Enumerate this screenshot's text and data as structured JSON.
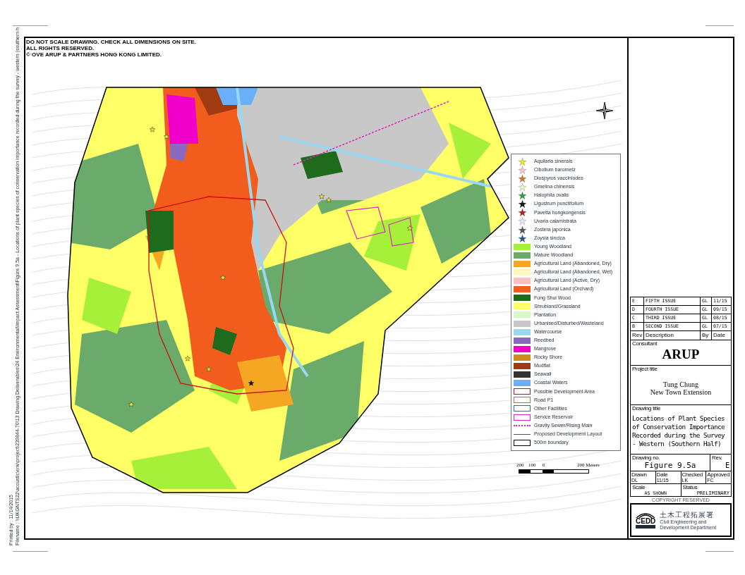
{
  "print_info": {
    "printed": "Printed by : 11/14/2015",
    "filename": "Filename : \\\\UKGNTS22\\acoustic\\env\\project\\239844-70\\13 Drawing Deliverables\\24 Environmental\\Impact Assessment\\Figure 9.5a - Locations of plant species of conservation importance recorded during the survey - western (southern h"
  },
  "notes": [
    "DO NOT SCALE DRAWING. CHECK ALL DIMENSIONS ON SITE.",
    "ALL RIGHTS RESERVED.",
    "© OVE ARUP & PARTNERS HONG KONG LIMITED."
  ],
  "legend": [
    {
      "kind": "star",
      "label": "Aquilaria sinensis",
      "color": "#e6e62e"
    },
    {
      "kind": "star",
      "label": "Cibotium barometz",
      "color": "#f2c4d4"
    },
    {
      "kind": "star",
      "label": "Diospyros vacciniodes",
      "color": "#c87832"
    },
    {
      "kind": "star",
      "label": "Gmelina chinensis",
      "color": "#eef0c8"
    },
    {
      "kind": "star",
      "label": "Halophila ovalis",
      "color": "#2e9e3e"
    },
    {
      "kind": "star",
      "label": "Ligustrum punctifolium",
      "color": "#111111"
    },
    {
      "kind": "star",
      "label": "Pavetta hongkongensis",
      "color": "#b02020"
    },
    {
      "kind": "star",
      "label": "Uvaria calamistrata",
      "color": "#e0e8f8"
    },
    {
      "kind": "star",
      "label": "Zostera japonica",
      "color": "#555555"
    },
    {
      "kind": "star",
      "label": "Zoysia sincica",
      "color": "#2a5a8a"
    },
    {
      "kind": "fill",
      "label": "Young Woodland",
      "color": "#a6f03a"
    },
    {
      "kind": "fill",
      "label": "Mature Woodland",
      "color": "#6aaa6a"
    },
    {
      "kind": "fill",
      "label": "Agricultural Land (Abandoned, Dry)",
      "color": "#f5a623"
    },
    {
      "kind": "fill",
      "label": "Agricultural Land (Abandoned, Wet)",
      "color": "#fff6c0"
    },
    {
      "kind": "fill",
      "label": "Agricultural Land (Active, Dry)",
      "color": "#f8c0c0"
    },
    {
      "kind": "fill",
      "label": "Agricultural Land (Orchard)",
      "color": "#f25c1c"
    },
    {
      "kind": "fill",
      "label": "Fung Shui Wood",
      "color": "#1e6b1e"
    },
    {
      "kind": "fill",
      "label": "Shrubland/Grassland",
      "color": "#ffff66"
    },
    {
      "kind": "fill",
      "label": "Plantation",
      "color": "#d8f8c8"
    },
    {
      "kind": "fill",
      "label": "Urbanised/Disturbed/Wasteland",
      "color": "#c8c8c8"
    },
    {
      "kind": "fill",
      "label": "Watercourse",
      "color": "#9ad8f2"
    },
    {
      "kind": "fill",
      "label": "Reedbed",
      "color": "#8a6ac0"
    },
    {
      "kind": "fill",
      "label": "Mangrove",
      "color": "#f000c8"
    },
    {
      "kind": "fill",
      "label": "Rocky Shore",
      "color": "#d08a20"
    },
    {
      "kind": "fill",
      "label": "Mudflat",
      "color": "#a03a10"
    },
    {
      "kind": "fill",
      "label": "Seawall",
      "color": "#333333"
    },
    {
      "kind": "fill",
      "label": "Coastal Waters",
      "color": "#6ab0f8"
    },
    {
      "kind": "outline",
      "label": "Possible Development Area",
      "color": "#d01010"
    },
    {
      "kind": "outline",
      "label": "Road P1",
      "color": "#b07820"
    },
    {
      "kind": "outline",
      "label": "Other Facilities",
      "color": "#1070e0"
    },
    {
      "kind": "outline",
      "label": "Service Reservoir",
      "color": "#e020c0"
    },
    {
      "kind": "dashed",
      "label": "Gravity Sewer/Rising Main",
      "color": "#e020c0"
    },
    {
      "kind": "line",
      "label": "Proposed Development Layout",
      "color": "#555555"
    },
    {
      "kind": "outline",
      "label": "500m boundary",
      "color": "#000000"
    }
  ],
  "scale_bar": {
    "labels": [
      "200",
      "100",
      "0",
      "200 Meters"
    ]
  },
  "revisions": [
    {
      "rev": "E",
      "description": "FIFTH ISSUE",
      "by": "GL",
      "date": "11/15"
    },
    {
      "rev": "D",
      "description": "FOURTH ISSUE",
      "by": "GL",
      "date": "09/15"
    },
    {
      "rev": "C",
      "description": "THIRD ISSUE",
      "by": "GL",
      "date": "08/15"
    },
    {
      "rev": "B",
      "description": "SECOND ISSUE",
      "by": "GL",
      "date": "07/15"
    }
  ],
  "revision_headers": [
    "Rev",
    "Description",
    "By",
    "Date"
  ],
  "consultant": {
    "label": "Consultant",
    "name": "ARUP"
  },
  "project": {
    "label": "Project title",
    "lines": [
      "Tung Chung",
      "New Town Extension"
    ]
  },
  "drawing_title": {
    "label": "Drawing title",
    "text": "Locations of Plant Species of Conservation Importance Recorded during the Survey - Western (Southern Half)"
  },
  "drawing_no": {
    "label": "Drawing no.",
    "value": "Figure 9.5a",
    "rev_label": "Rev.",
    "rev": "E"
  },
  "details": [
    {
      "label": "Drawn",
      "value": "DL"
    },
    {
      "label": "Date",
      "value": "11/15"
    },
    {
      "label": "Checked",
      "value": "LK"
    },
    {
      "label": "Approved",
      "value": "FC"
    }
  ],
  "scale": {
    "label": "Scale",
    "value": "AS SHOWN"
  },
  "status": {
    "label": "Status",
    "value": "PRELIMINARY"
  },
  "copyright": "COPYRIGHT RESERVED",
  "agency": {
    "logo_text": "CEDD",
    "chinese": "土木工程拓展署",
    "lines": [
      "Civil Engineering and",
      "Development Department"
    ]
  }
}
